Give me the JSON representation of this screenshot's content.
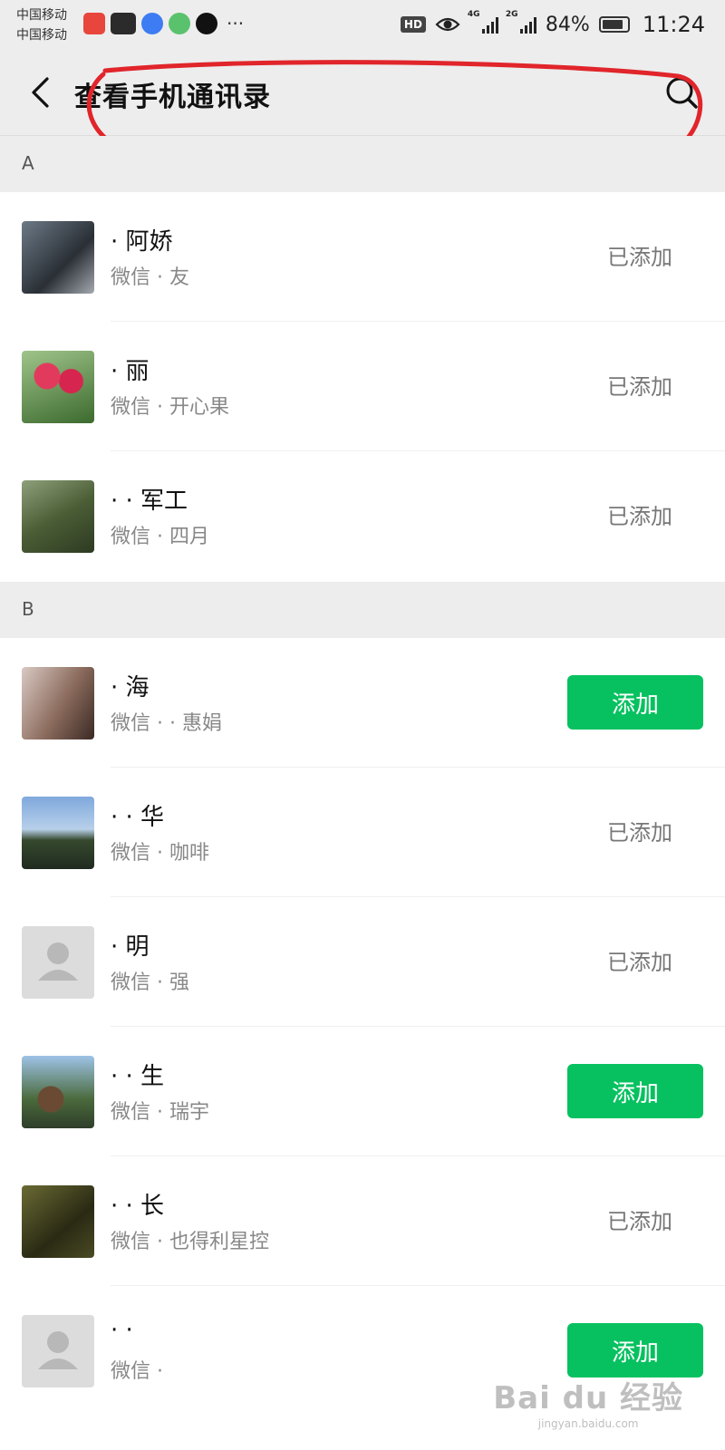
{
  "status_bar": {
    "carrier_1": "中国移动",
    "carrier_2": "中国移动",
    "hd": "HD",
    "net_1": "4G",
    "net_2": "2G",
    "battery": "84%",
    "time": "11:24",
    "more": "···"
  },
  "header": {
    "title": "查看手机通讯录",
    "back_icon": "chevron-left-icon",
    "search_icon": "search-icon"
  },
  "sections": [
    "A",
    "B"
  ],
  "contacts": [
    {
      "name": "· 阿娇",
      "subtitle": "微信 · 友",
      "status": "已添加",
      "avatar": "photo-portrait"
    },
    {
      "name": "· 丽",
      "subtitle": "微信 · 开心果",
      "status": "已添加",
      "avatar": "photo-flowers"
    },
    {
      "name": "· · 军工",
      "subtitle": "微信 · 四月",
      "status": "已添加",
      "avatar": "photo-trees"
    },
    {
      "name": "· 海",
      "subtitle": "微信 · · 惠娟",
      "status": "添加",
      "avatar": "photo-person"
    },
    {
      "name": "· · 华",
      "subtitle": "微信 · 咖啡",
      "status": "已添加",
      "avatar": "photo-mountains"
    },
    {
      "name": "· 明",
      "subtitle": "微信 · 强",
      "status": "已添加",
      "avatar": "default-user"
    },
    {
      "name": "· · 生",
      "subtitle": "微信 · 瑞宇",
      "status": "添加",
      "avatar": "photo-pinecones"
    },
    {
      "name": "· · 长",
      "subtitle": "微信 · 也得利星控",
      "status": "已添加",
      "avatar": "photo-dark"
    },
    {
      "name": "· ·",
      "subtitle": "微信 ·",
      "status": "添加",
      "avatar": "default-user"
    }
  ],
  "watermark": {
    "main": "Bai du 经验",
    "sub": "jingyan.baidu.com"
  },
  "colors": {
    "accent_green": "#07c160",
    "annotation_red": "#e0252b",
    "section_bg": "#ededed"
  }
}
